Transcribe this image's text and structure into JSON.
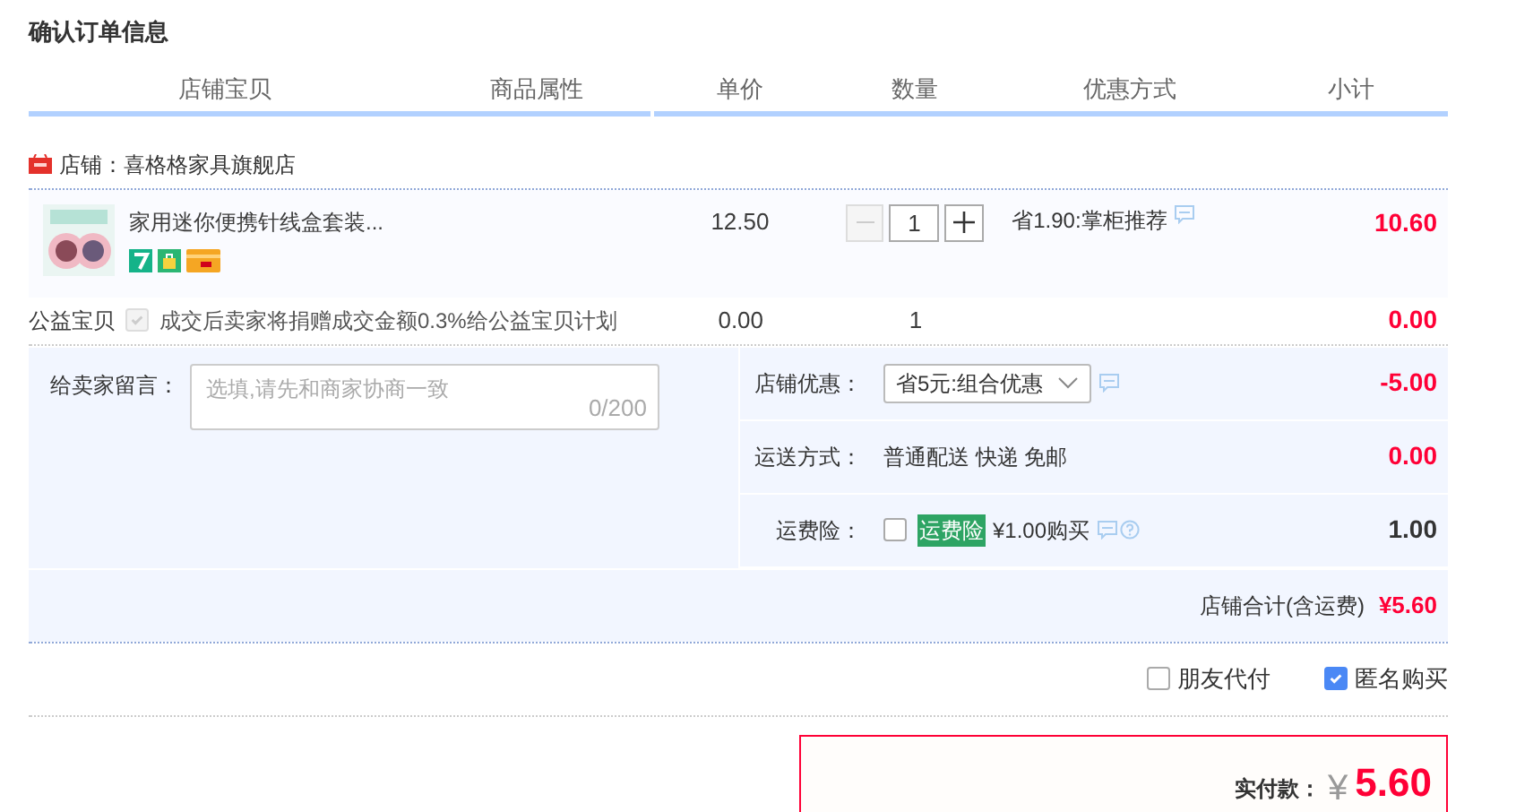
{
  "title": "确认订单信息",
  "columns": [
    "店铺宝贝",
    "商品属性",
    "单价",
    "数量",
    "优惠方式",
    "小计"
  ],
  "shop": {
    "label": "店铺：喜格格家具旗舰店"
  },
  "item": {
    "name": "家用迷你便携针线盒套装...",
    "price": "12.50",
    "quantity": "1",
    "discount": "省1.90:掌柜推荐",
    "subtotal": "10.60"
  },
  "charity": {
    "label": "公益宝贝",
    "checked": true,
    "disabled": true,
    "text": "成交后卖家将捐赠成交金额0.3%给公益宝贝计划",
    "price": "0.00",
    "quantity": "1",
    "subtotal": "0.00"
  },
  "message": {
    "label": "给卖家留言：",
    "placeholder": "选填,请先和商家协商一致",
    "counter": "0/200"
  },
  "options": [
    {
      "kind": "select",
      "label": "店铺优惠：",
      "value": "省5元:组合优惠",
      "amount": "-5.00",
      "highlight": true
    },
    {
      "kind": "text",
      "label": "运送方式：",
      "value": "普通配送 快递 免邮",
      "amount": "0.00",
      "highlight": true
    },
    {
      "kind": "insurance",
      "label": "运费险：",
      "checked": false,
      "tag": "运费险",
      "value": "¥1.00购买",
      "amount": "1.00",
      "highlight": false
    }
  ],
  "shop_total": {
    "label": "店铺合计(含运费)",
    "value": "¥5.60"
  },
  "checkboxes": [
    {
      "label": "朋友代付",
      "checked": false
    },
    {
      "label": "匿名购买",
      "checked": true
    }
  ],
  "payment": {
    "label": "实付款：",
    "currency": "¥",
    "value": "5.60"
  }
}
